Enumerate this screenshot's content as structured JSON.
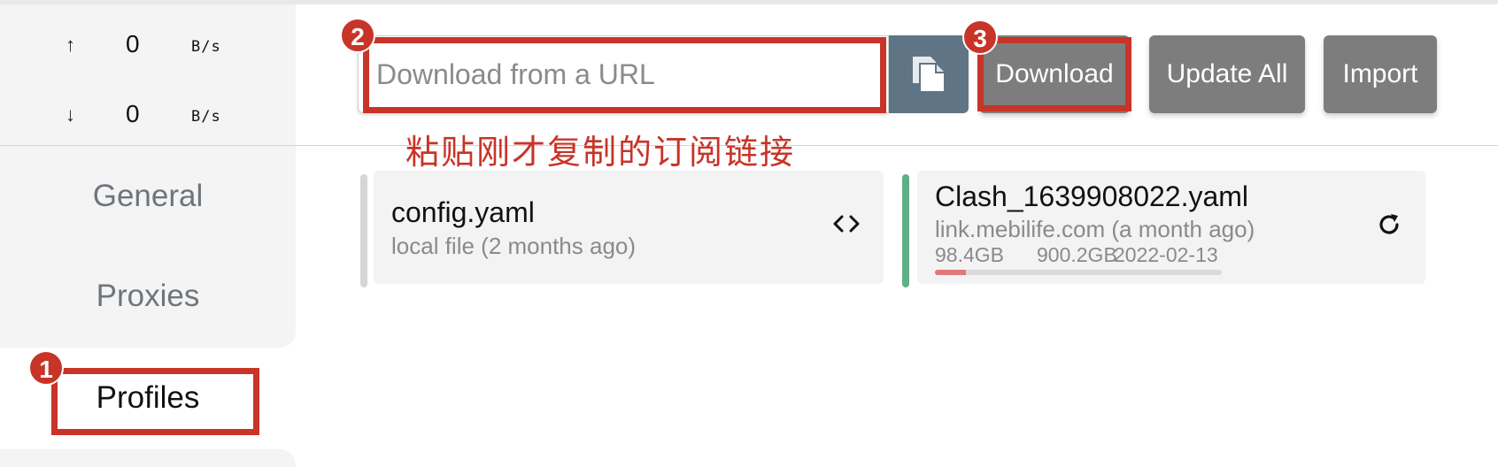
{
  "traffic": {
    "up": {
      "arrow": "↑",
      "value": "0",
      "unit": "B/s"
    },
    "down": {
      "arrow": "↓",
      "value": "0",
      "unit": "B/s"
    }
  },
  "sidebar": {
    "items": [
      {
        "label": "General"
      },
      {
        "label": "Proxies"
      },
      {
        "label": "Profiles"
      }
    ]
  },
  "toolbar": {
    "url_placeholder": "Download from a URL",
    "url_value": "",
    "download_label": "Download",
    "update_all_label": "Update All",
    "import_label": "Import"
  },
  "annotations": {
    "badge1": "1",
    "badge2": "2",
    "badge3": "3",
    "instruction": "粘贴刚才复制的订阅链接",
    "color": "#c83428"
  },
  "profiles": [
    {
      "name": "config.yaml",
      "source": "local file (2 months ago)",
      "icon": "code-icon",
      "indicator_color": "#d6d6d6"
    },
    {
      "name": "Clash_1639908022.yaml",
      "source": "link.mebilife.com (a month ago)",
      "used": "98.4GB",
      "total": "900.2GB",
      "expires": "2022-02-13",
      "usage_fraction": 0.109,
      "icon": "refresh-icon",
      "indicator_color": "#5fb084"
    }
  ],
  "colors": {
    "button": "#7d7d7d",
    "paste_button": "#5f7585",
    "progress": "#e0787b"
  }
}
